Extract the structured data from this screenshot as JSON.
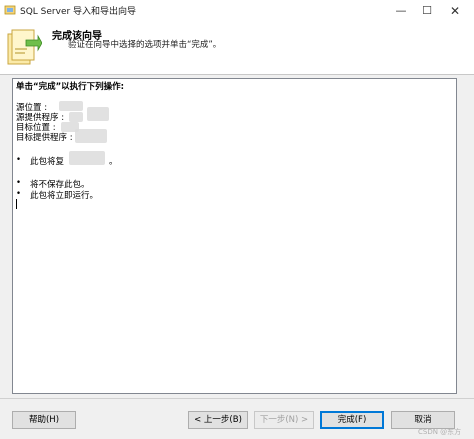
{
  "window": {
    "title": "SQL Server 导入和导出向导",
    "controls": {
      "minimize": "—",
      "maximize": "☐",
      "close": "✕"
    }
  },
  "header": {
    "title": "完成该向导",
    "subtitle": "验证在向导中选择的选项并单击“完成”。",
    "icon": "wizard-icon"
  },
  "summary": {
    "heading": "单击“完成”以执行下列操作:",
    "fields": [
      {
        "label": "源位置 :"
      },
      {
        "label": "源提供程序 :"
      },
      {
        "label": "目标位置 :"
      },
      {
        "label": "目标提供程序 :"
      }
    ],
    "bullets": [
      {
        "glyph": "•",
        "text": "此包将复",
        "suffix": "。"
      },
      {
        "glyph": "•",
        "text": "将不保存此包。"
      },
      {
        "glyph": "•",
        "text": "此包将立即运行。"
      }
    ]
  },
  "buttons": {
    "help": "帮助(H)",
    "back": "< 上一步(B)",
    "next": "下一步(N) >",
    "finish": "完成(F)",
    "cancel": "取消"
  },
  "watermark": "CSDN @东方"
}
